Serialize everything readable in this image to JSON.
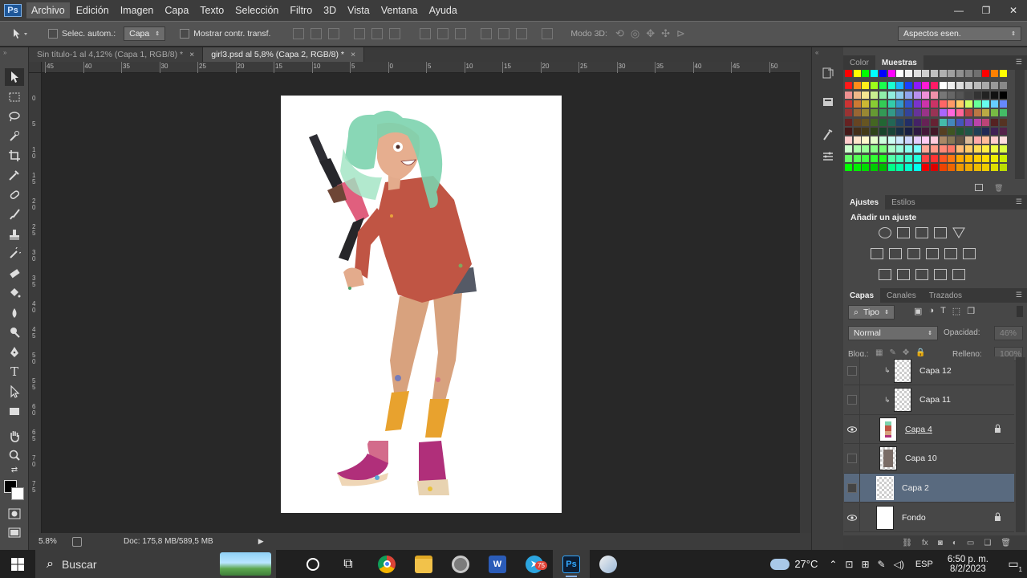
{
  "menubar": {
    "logo": "Ps",
    "items": [
      "Archivo",
      "Edición",
      "Imagen",
      "Capa",
      "Texto",
      "Selección",
      "Filtro",
      "3D",
      "Vista",
      "Ventana",
      "Ayuda"
    ],
    "window_controls": [
      "—",
      "❐",
      "✕"
    ]
  },
  "options": {
    "auto_select_label": "Selec. autom.:",
    "auto_select_value": "Capa",
    "show_transform_label": "Mostrar contr. transf.",
    "mode3d_label": "Modo 3D:",
    "workspace_value": "Aspectos esen."
  },
  "tabs": [
    {
      "label": "Sin título-1 al 4,12% (Capa 1, RGB/8) *",
      "close": "×"
    },
    {
      "label": "girl3.psd al 5,8% (Capa 2, RGB/8) *",
      "close": "×"
    }
  ],
  "rulers": {
    "h": [
      "45",
      "40",
      "35",
      "30",
      "25",
      "20",
      "15",
      "10",
      "5",
      "0",
      "5",
      "10",
      "15",
      "20",
      "25",
      "30",
      "35",
      "40",
      "45",
      "50"
    ],
    "v": [
      "0",
      "5",
      "1 0",
      "1 5",
      "2 0",
      "2 5",
      "3 0",
      "3 5",
      "4 0",
      "4 5",
      "5 0",
      "5 5",
      "6 0",
      "6 5",
      "7 0",
      "7 5"
    ]
  },
  "statusbar": {
    "zoom": "5.8%",
    "doc": "Doc: 175,8 MB/589,5 MB"
  },
  "panels": {
    "color_tabs": [
      "Color",
      "Muestras"
    ],
    "adjust_tabs": [
      "Ajustes",
      "Estilos"
    ],
    "adjust_title": "Añadir un ajuste",
    "layers_tabs": [
      "Capas",
      "Canales",
      "Trazados"
    ],
    "filter_kind": "Tipo",
    "blend_mode": "Normal",
    "opacity_label": "Opacidad:",
    "opacity_value": "46%",
    "lock_label": "Bloq.:",
    "fill_label": "Relleno:",
    "fill_value": "100%"
  },
  "layers": [
    {
      "name": "Capa 12",
      "visible": false,
      "clipped": true,
      "locked": false,
      "selected": false
    },
    {
      "name": "Capa 11",
      "visible": false,
      "clipped": true,
      "locked": false,
      "selected": false
    },
    {
      "name": "Capa 4",
      "visible": true,
      "clipped": false,
      "locked": true,
      "selected": false
    },
    {
      "name": "Capa 10",
      "visible": false,
      "clipped": false,
      "locked": false,
      "selected": false
    },
    {
      "name": "Capa 2",
      "visible": false,
      "clipped": false,
      "locked": false,
      "selected": true
    },
    {
      "name": "Fondo",
      "visible": true,
      "clipped": false,
      "locked": true,
      "selected": false
    }
  ],
  "taskbar": {
    "search_placeholder": "Buscar",
    "badge": "75",
    "weather": "27°C",
    "lang": "ESP",
    "time": "6:50 p. m.",
    "date": "8/2/2023",
    "notifications": "1"
  },
  "colors": {
    "accent_selected": "#596a7f",
    "canvas": "#ffffff",
    "workspace": "#282828"
  }
}
